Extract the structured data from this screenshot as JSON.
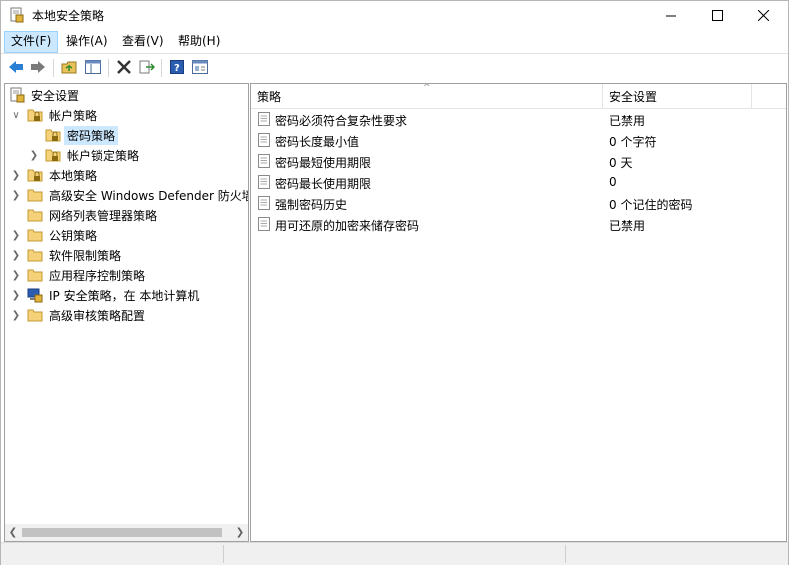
{
  "window": {
    "title": "本地安全策略"
  },
  "menu": [
    {
      "label": "文件(F)",
      "active": true
    },
    {
      "label": "操作(A)"
    },
    {
      "label": "查看(V)"
    },
    {
      "label": "帮助(H)"
    }
  ],
  "tree": [
    {
      "label": "安全设置",
      "icon": "security-settings-icon",
      "expander": ""
    },
    {
      "label": "帐户策略",
      "icon": "folder-lock-icon",
      "expander": "v"
    },
    {
      "label": "密码策略",
      "icon": "folder-lock-icon",
      "expander": "",
      "selected": true
    },
    {
      "label": "帐户锁定策略",
      "icon": "folder-lock-icon",
      "expander": ">"
    },
    {
      "label": "本地策略",
      "icon": "folder-lock-icon",
      "expander": ">"
    },
    {
      "label": "高级安全 Windows Defender 防火墙",
      "icon": "folder-icon",
      "expander": ">"
    },
    {
      "label": "网络列表管理器策略",
      "icon": "folder-icon",
      "expander": ""
    },
    {
      "label": "公钥策略",
      "icon": "folder-icon",
      "expander": ">"
    },
    {
      "label": "软件限制策略",
      "icon": "folder-icon",
      "expander": ">"
    },
    {
      "label": "应用程序控制策略",
      "icon": "folder-icon",
      "expander": ">"
    },
    {
      "label": "IP 安全策略，在 本地计算机",
      "icon": "ip-security-icon",
      "expander": ">"
    },
    {
      "label": "高级审核策略配置",
      "icon": "folder-icon",
      "expander": ">"
    }
  ],
  "list": {
    "headers": {
      "policy": "策略",
      "setting": "安全设置"
    },
    "rows": [
      {
        "policy": "密码必须符合复杂性要求",
        "setting": "已禁用"
      },
      {
        "policy": "密码长度最小值",
        "setting": "0 个字符"
      },
      {
        "policy": "密码最短使用期限",
        "setting": "0 天"
      },
      {
        "policy": "密码最长使用期限",
        "setting": "0"
      },
      {
        "policy": "强制密码历史",
        "setting": "0 个记住的密码"
      },
      {
        "policy": "用可还原的加密来储存密码",
        "setting": "已禁用"
      }
    ]
  },
  "colors": {
    "accent": "#cce8ff",
    "menu_border": "#99d1ff",
    "back_arrow": "#2a7fd4"
  }
}
